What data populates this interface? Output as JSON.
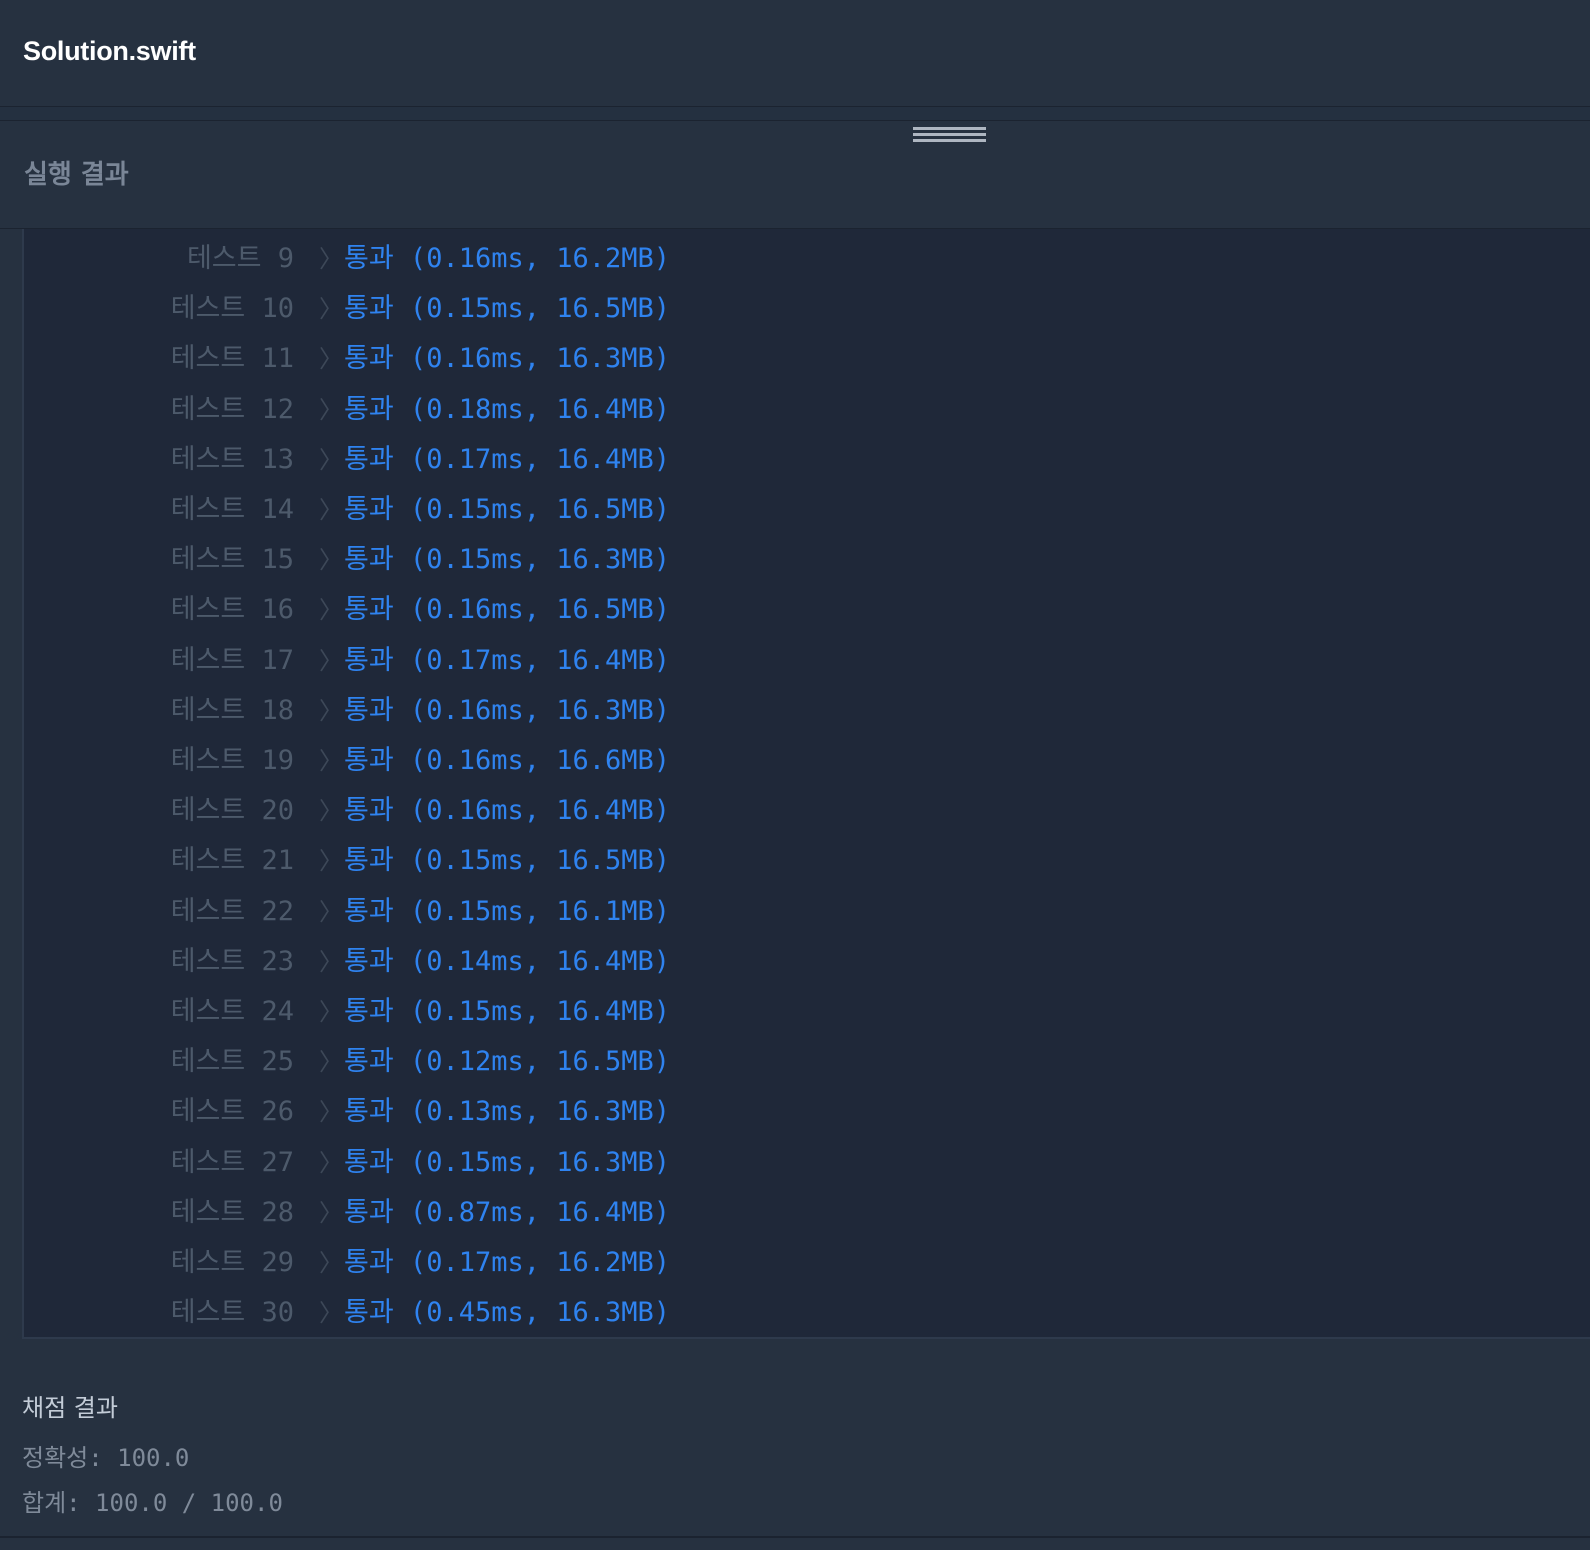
{
  "header": {
    "filename": "Solution.swift"
  },
  "results_panel": {
    "title": "실행 결과"
  },
  "tests": [
    {
      "label": "테스트 9",
      "result": "통과 (0.16ms, 16.2MB)"
    },
    {
      "label": "테스트 10",
      "result": "통과 (0.15ms, 16.5MB)"
    },
    {
      "label": "테스트 11",
      "result": "통과 (0.16ms, 16.3MB)"
    },
    {
      "label": "테스트 12",
      "result": "통과 (0.18ms, 16.4MB)"
    },
    {
      "label": "테스트 13",
      "result": "통과 (0.17ms, 16.4MB)"
    },
    {
      "label": "테스트 14",
      "result": "통과 (0.15ms, 16.5MB)"
    },
    {
      "label": "테스트 15",
      "result": "통과 (0.15ms, 16.3MB)"
    },
    {
      "label": "테스트 16",
      "result": "통과 (0.16ms, 16.5MB)"
    },
    {
      "label": "테스트 17",
      "result": "통과 (0.17ms, 16.4MB)"
    },
    {
      "label": "테스트 18",
      "result": "통과 (0.16ms, 16.3MB)"
    },
    {
      "label": "테스트 19",
      "result": "통과 (0.16ms, 16.6MB)"
    },
    {
      "label": "테스트 20",
      "result": "통과 (0.16ms, 16.4MB)"
    },
    {
      "label": "테스트 21",
      "result": "통과 (0.15ms, 16.5MB)"
    },
    {
      "label": "테스트 22",
      "result": "통과 (0.15ms, 16.1MB)"
    },
    {
      "label": "테스트 23",
      "result": "통과 (0.14ms, 16.4MB)"
    },
    {
      "label": "테스트 24",
      "result": "통과 (0.15ms, 16.4MB)"
    },
    {
      "label": "테스트 25",
      "result": "통과 (0.12ms, 16.5MB)"
    },
    {
      "label": "테스트 26",
      "result": "통과 (0.13ms, 16.3MB)"
    },
    {
      "label": "테스트 27",
      "result": "통과 (0.15ms, 16.3MB)"
    },
    {
      "label": "테스트 28",
      "result": "통과 (0.87ms, 16.4MB)"
    },
    {
      "label": "테스트 29",
      "result": "통과 (0.17ms, 16.2MB)"
    },
    {
      "label": "테스트 30",
      "result": "통과 (0.45ms, 16.3MB)"
    }
  ],
  "grading": {
    "title": "채점 결과",
    "accuracy": "정확성: 100.0",
    "total": "합계: 100.0 / 100.0"
  },
  "colors": {
    "pass": "#2f83f0",
    "label": "#4d5a6b",
    "background": "#263140",
    "output_background": "#1f2839"
  }
}
